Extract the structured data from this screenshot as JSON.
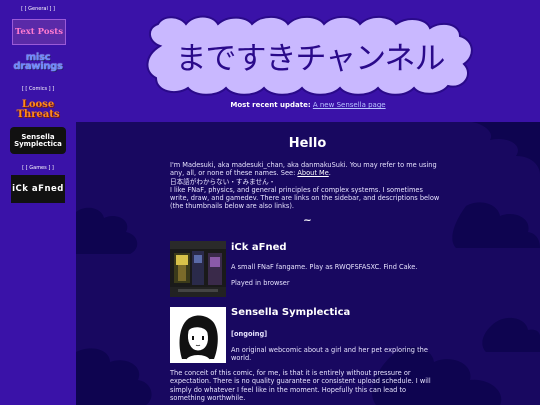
{
  "sidebar": {
    "general_label": "[ [ General ] ]",
    "comics_label": "[ [ Comics ] ]",
    "games_label": "[ [ Games ] ]",
    "items": [
      {
        "label": "Text Posts"
      },
      {
        "label": "misc drawings"
      },
      {
        "label": "Loose Threats"
      },
      {
        "label": "Sensella Symplectica"
      },
      {
        "label": "iCk aFned"
      }
    ]
  },
  "header": {
    "title": "まですきチャンネル",
    "recent_prefix": "Most recent update:",
    "recent_link": "A new Sensella page"
  },
  "main": {
    "heading": "Hello",
    "intro_1": "I'm Madesuki, aka madesuki_chan, aka danmakuSuki. You may refer to me using any, all, or none of these names. See:",
    "about_link": "About Me",
    "intro_2": "日本語がわからない・すみません・",
    "intro_3": "I like FNaF, physics, and general principles of complex systems. I sometimes write, draw, and gamedev. There are links on the sidebar, and descriptions below (the thumbnails below are also links).",
    "divider": "~",
    "game": {
      "title": "iCk aFned",
      "desc": "A small FNaF fangame. Play as RWQFSFASXC. Find Cake.",
      "note": "Played in browser"
    },
    "comic": {
      "title": "Sensella Symplectica",
      "status": "[ongoing]",
      "desc": "An original webcomic about a girl and her pet exploring the world."
    },
    "conceit": "The conceit of this comic, for me, is that it is entirely without pressure or expectation. There is no quality guarantee or consistent upload schedule. I will simply do whatever I feel like in the moment. Hopefully this can lead to something worthwhile."
  },
  "colors": {
    "background": "#3a12a8",
    "panel": "#180860",
    "banner": "#c9b8ff",
    "link": "#b8c4ff"
  }
}
